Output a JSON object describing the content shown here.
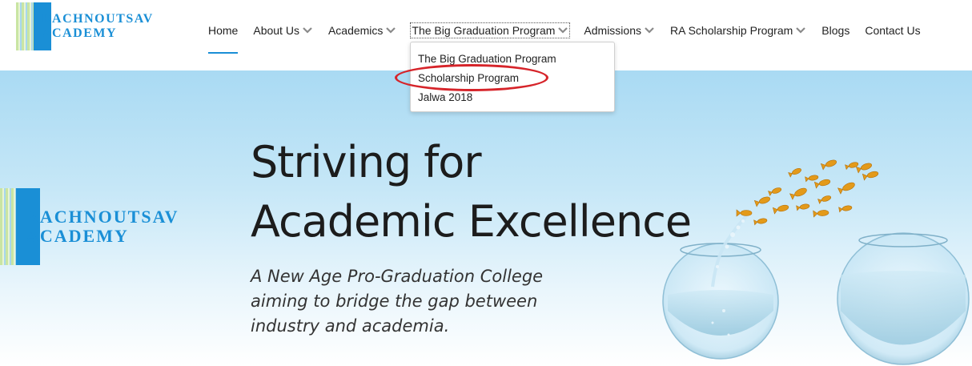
{
  "brand": {
    "name_line1": "RACHNOUTSAV",
    "name_line2": "ACADEMY"
  },
  "nav": {
    "items": [
      {
        "label": "Home",
        "has_dropdown": false,
        "active": true
      },
      {
        "label": "About Us",
        "has_dropdown": true
      },
      {
        "label": "Academics",
        "has_dropdown": true
      },
      {
        "label": "The Big Graduation Program",
        "has_dropdown": true,
        "expanded": true
      },
      {
        "label": "Admissions",
        "has_dropdown": true
      },
      {
        "label": "RA Scholarship Program",
        "has_dropdown": true
      },
      {
        "label": "Blogs",
        "has_dropdown": false
      },
      {
        "label": "Contact Us",
        "has_dropdown": false
      }
    ],
    "dropdown": {
      "items": [
        {
          "label": "The Big Graduation Program"
        },
        {
          "label": "Scholarship Program",
          "circled": true
        },
        {
          "label": "Jalwa 2018"
        }
      ]
    }
  },
  "hero": {
    "headline_line1": "Striving for",
    "headline_line2": "Academic Excellence",
    "subline_line1": "A New Age Pro-Graduation College",
    "subline_line2": "aiming to bridge the gap between",
    "subline_line3": "industry and academia.",
    "logo_line1": "RACHNOUTSAV",
    "logo_line2": "ACADEMY"
  },
  "colors": {
    "brand_blue": "#1a8fd6",
    "highlight_red": "#d6242a",
    "hero_top": "#a9daf3"
  }
}
